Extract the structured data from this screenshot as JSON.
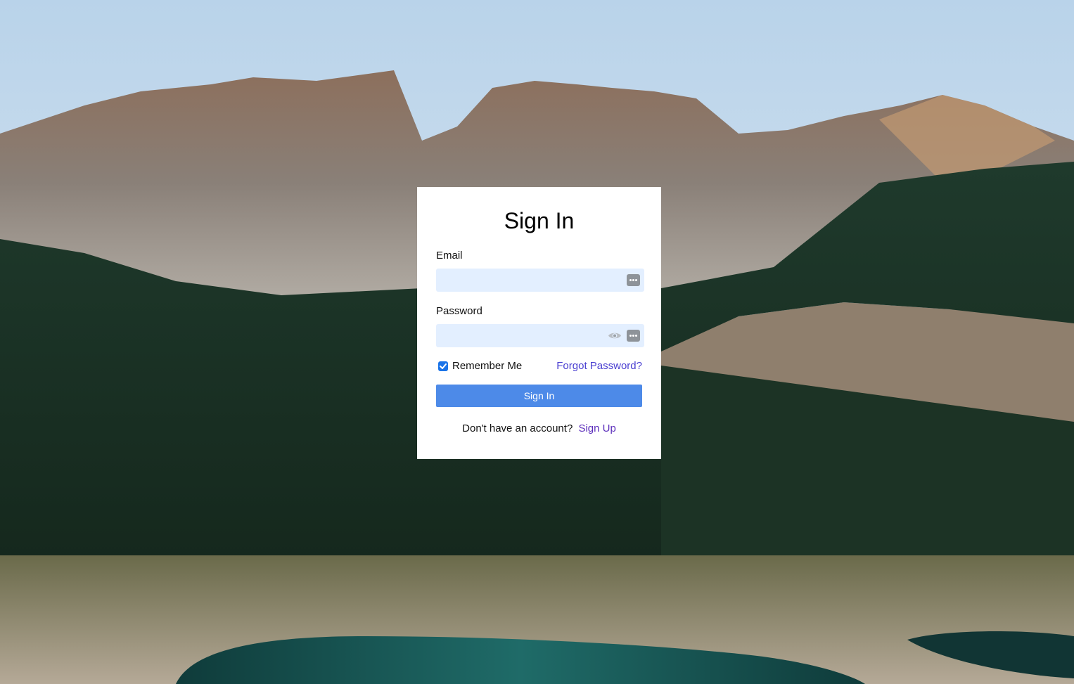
{
  "background": {
    "scene": "mountains-forest-lake-photo"
  },
  "signin_card": {
    "title": "Sign In",
    "email": {
      "label": "Email",
      "value": "",
      "placeholder": ""
    },
    "password": {
      "label": "Password",
      "value": "",
      "placeholder": ""
    },
    "remember_me": {
      "label": "Remember Me",
      "checked": true
    },
    "forgot_password_label": "Forgot Password?",
    "submit_label": "Sign In",
    "signup_prompt": "Don't have an account?",
    "signup_link_label": "Sign Up"
  },
  "colors": {
    "field_bg": "#e3efff",
    "button": "#4d8ae8",
    "forgot_link": "#4a3fd1",
    "signup_link": "#5b2dbb",
    "checkbox": "#1a73e8"
  }
}
